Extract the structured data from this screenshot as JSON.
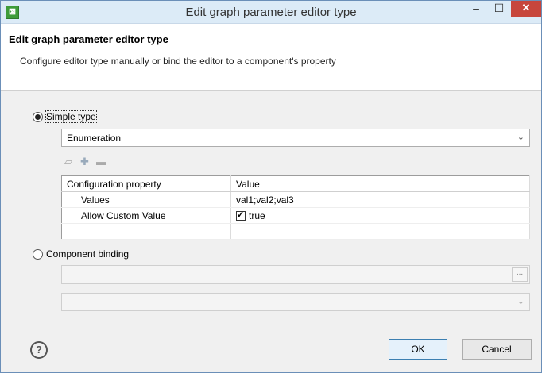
{
  "window": {
    "title": "Edit graph parameter editor type"
  },
  "header": {
    "title": "Edit graph parameter editor type",
    "description": "Configure editor type manually or bind the editor to a component's property"
  },
  "simple_type": {
    "label": "Simple type",
    "selected": true,
    "editor_value": "Enumeration",
    "toolbar_icons": [
      "edit-icon",
      "add-icon",
      "remove-icon"
    ]
  },
  "properties_table": {
    "headers": [
      "Configuration property",
      "Value"
    ],
    "rows": [
      {
        "property": "Values",
        "value": "val1;val2;val3"
      },
      {
        "property": "Allow Custom Value",
        "value": "true",
        "checked": true
      }
    ]
  },
  "component_binding": {
    "label": "Component binding",
    "selected": false,
    "component_value": "",
    "browse_label": "...",
    "property_value": ""
  },
  "buttons": {
    "ok": "OK",
    "cancel": "Cancel",
    "help": "?"
  }
}
